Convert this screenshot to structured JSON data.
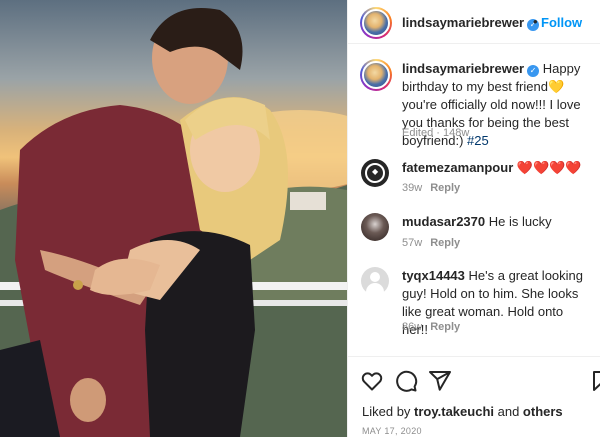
{
  "post": {
    "username": "lindsaymariebrewer",
    "verified_icon": "verified-badge-icon",
    "separator": "•",
    "follow_label": "Follow"
  },
  "caption": {
    "username": "lindsaymariebrewer",
    "text": "Happy birthday to my best friend",
    "emoji": "💛",
    "text2": " you're officially old now!!! I love you thanks for being the best boyfriend:) ",
    "hashtag": "#25",
    "meta": "Edited · 148w"
  },
  "comments": [
    {
      "username": "fatemezamanpour",
      "text": "❤️❤️❤️❤️",
      "time": "39w",
      "reply": "Reply"
    },
    {
      "username": "mudasar2370",
      "text": "He is lucky",
      "time": "57w",
      "reply": "Reply"
    },
    {
      "username": "tyqx14443",
      "text": "He's a great looking guy! Hold on to him. She looks like great woman. Hold onto her!!",
      "time": "86w",
      "reply": "Reply"
    }
  ],
  "actions": {
    "like_icon": "heart-icon",
    "comment_icon": "comment-icon",
    "share_icon": "share-icon",
    "save_icon": "bookmark-icon"
  },
  "likes": {
    "prefix": "Liked by ",
    "user": "troy.takeuchi",
    "and": " and ",
    "others": "others"
  },
  "date": "MAY 17, 2020",
  "colors": {
    "accent": "#0095f6",
    "verified": "#3897f0",
    "hashtag": "#00376b",
    "secondary_text": "#8e8e8e"
  }
}
